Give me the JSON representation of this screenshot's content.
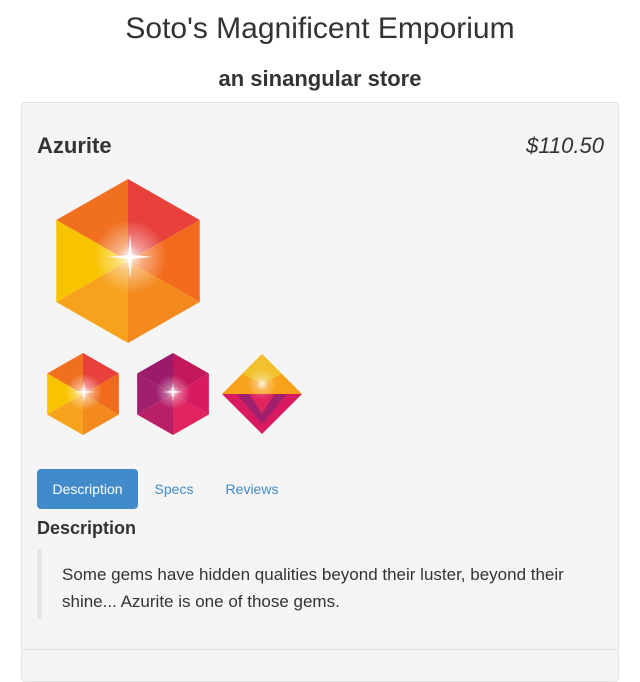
{
  "store": {
    "title": "Soto's Magnificent Emporium",
    "subtitle": "an sinangular store"
  },
  "product": {
    "name": "Azurite",
    "price": "$110.50",
    "main_image_icon": "orange-hexagon-gem-icon",
    "thumbnails": [
      {
        "icon": "orange-hexagon-gem-icon"
      },
      {
        "icon": "pink-hexagon-gem-icon"
      },
      {
        "icon": "pink-diamond-gem-icon"
      }
    ]
  },
  "tabs": {
    "items": [
      {
        "label": "Description",
        "active": true
      },
      {
        "label": "Specs",
        "active": false
      },
      {
        "label": "Reviews",
        "active": false
      }
    ]
  },
  "description": {
    "heading": "Description",
    "text": "Some gems have hidden qualities beyond their luster, beyond their shine... Azurite is one of those gems."
  },
  "colors": {
    "accent": "#428bca",
    "panel_background": "#f5f5f5",
    "panel_border": "#e3e3e3",
    "text": "#333333"
  }
}
